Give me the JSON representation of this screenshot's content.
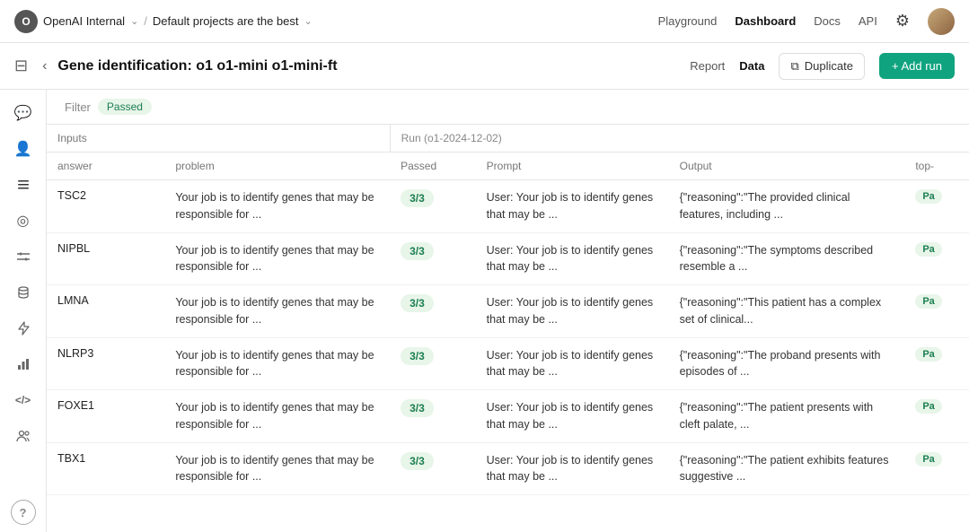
{
  "org": {
    "avatar_letter": "O",
    "name": "OpenAI Internal",
    "chevron": "⌄"
  },
  "breadcrumb": {
    "separator": "/",
    "project_name": "Default projects are the best",
    "chevron": "⌄"
  },
  "top_nav": {
    "links": [
      {
        "label": "Playground",
        "active": false
      },
      {
        "label": "Dashboard",
        "active": true
      },
      {
        "label": "Docs",
        "active": false
      },
      {
        "label": "API",
        "active": false
      }
    ]
  },
  "sub_header": {
    "back_label": "‹",
    "title": "Gene identification: o1 o1-mini o1-mini-ft",
    "report_label": "Report",
    "data_label": "Data",
    "duplicate_label": "Duplicate",
    "add_run_label": "+ Add run"
  },
  "filter_bar": {
    "filter_label": "Filter",
    "badge_label": "Passed"
  },
  "table": {
    "section_inputs": "Inputs",
    "section_run": "Run (o1-2024-12-02)",
    "headers": {
      "answer": "answer",
      "problem": "problem",
      "passed": "Passed",
      "prompt": "Prompt",
      "output": "Output",
      "top": "top‑"
    },
    "rows": [
      {
        "answer": "TSC2",
        "problem": "Your job is to identify genes that may be responsible for ...",
        "passed": "3/3",
        "prompt": "User: Your job is to identify genes that may be ...",
        "output": "{\"reasoning\":\"The provided clinical features, including ...",
        "top": "Pa"
      },
      {
        "answer": "NIPBL",
        "problem": "Your job is to identify genes that may be responsible for ...",
        "passed": "3/3",
        "prompt": "User: Your job is to identify genes that may be ...",
        "output": "{\"reasoning\":\"The symptoms described resemble a ...",
        "top": "Pa"
      },
      {
        "answer": "LMNA",
        "problem": "Your job is to identify genes that may be responsible for ...",
        "passed": "3/3",
        "prompt": "User: Your job is to identify genes that may be ...",
        "output": "{\"reasoning\":\"This patient has a complex set of clinical...",
        "top": "Pa"
      },
      {
        "answer": "NLRP3",
        "problem": "Your job is to identify genes that may be responsible for ...",
        "passed": "3/3",
        "prompt": "User: Your job is to identify genes that may be ...",
        "output": "{\"reasoning\":\"The proband presents with episodes of ...",
        "top": "Pa"
      },
      {
        "answer": "FOXE1",
        "problem": "Your job is to identify genes that may be responsible for ...",
        "passed": "3/3",
        "prompt": "User: Your job is to identify genes that may be ...",
        "output": "{\"reasoning\":\"The patient presents with cleft palate, ...",
        "top": "Pa"
      },
      {
        "answer": "TBX1",
        "problem": "Your job is to identify genes that may be responsible for ...",
        "passed": "3/3",
        "prompt": "User: Your job is to identify genes that may be ...",
        "output": "{\"reasoning\":\"The patient exhibits features suggestive ...",
        "top": "Pa"
      }
    ]
  },
  "sidebar_icons": [
    {
      "name": "chat-icon",
      "symbol": "💬"
    },
    {
      "name": "person-icon",
      "symbol": "👤"
    },
    {
      "name": "list-icon",
      "symbol": "☰"
    },
    {
      "name": "target-icon",
      "symbol": "◎"
    },
    {
      "name": "tune-icon",
      "symbol": "⚙"
    },
    {
      "name": "database-icon",
      "symbol": "🗄"
    },
    {
      "name": "settings-icon",
      "symbol": "⚡"
    },
    {
      "name": "chart-icon",
      "symbol": "📊"
    },
    {
      "name": "code-icon",
      "symbol": "‹/›"
    },
    {
      "name": "people-icon",
      "symbol": "👥"
    },
    {
      "name": "help-icon",
      "symbol": "?"
    }
  ]
}
